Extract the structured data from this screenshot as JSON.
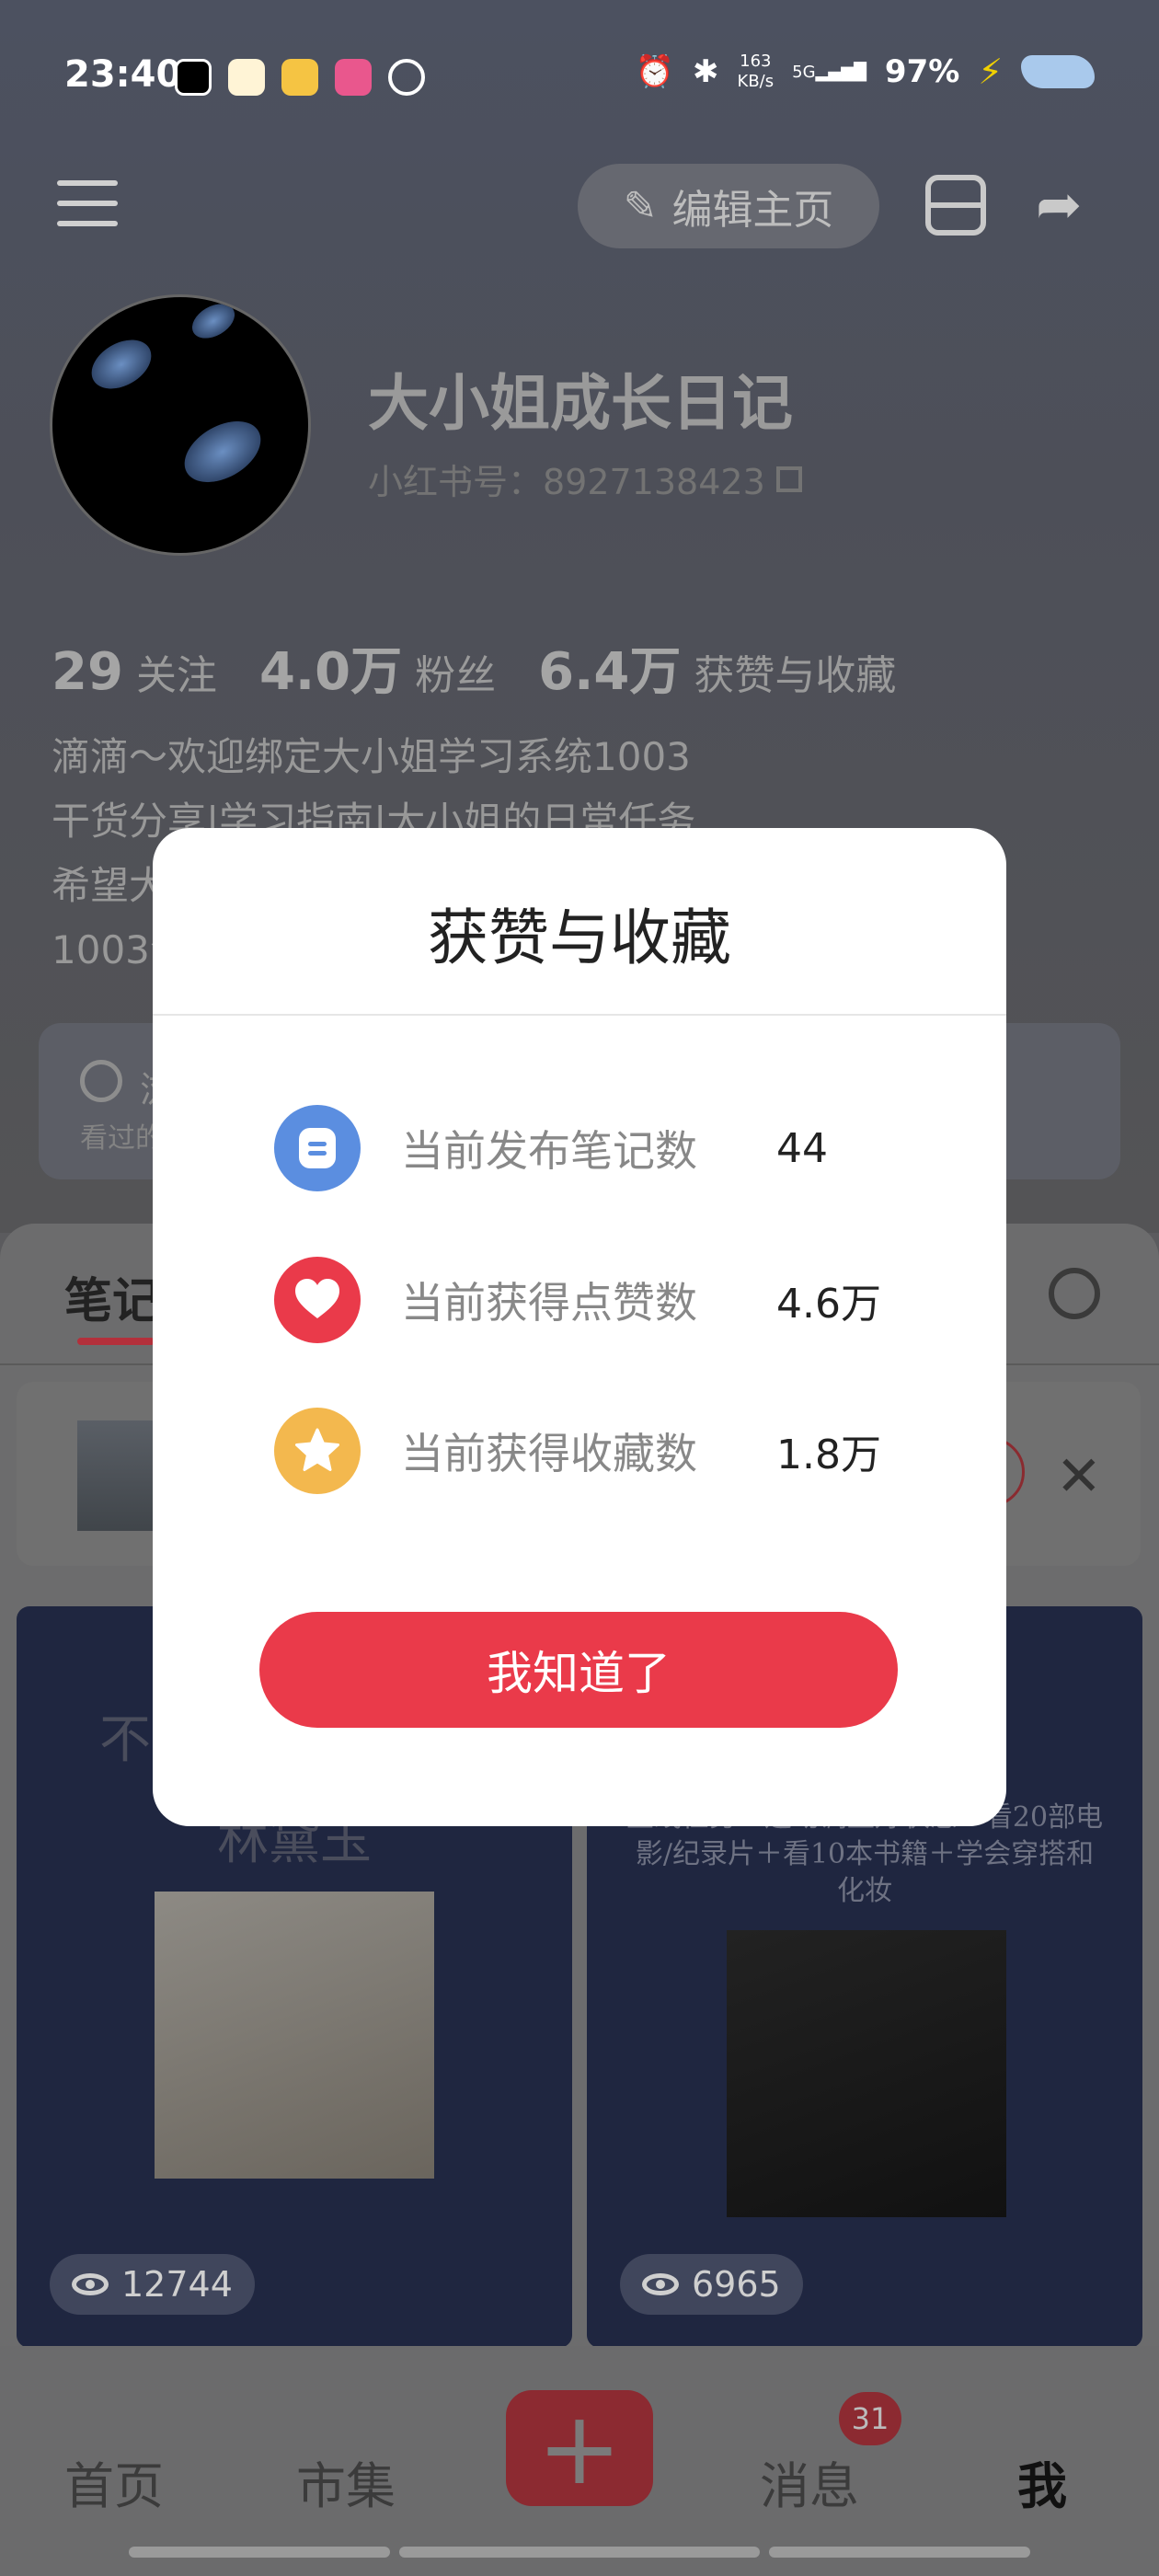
{
  "status_bar": {
    "time": "23:40",
    "net_speed_value": "163",
    "net_speed_unit": "KB/s",
    "signal_label": "5G",
    "battery": "97%"
  },
  "header": {
    "edit_profile_label": "编辑主页"
  },
  "profile": {
    "name": "大小姐成长日记",
    "id_line": "小红书号：8927138423",
    "stats": [
      {
        "value": "29",
        "label": "关注"
      },
      {
        "value": "4.0万",
        "label": "粉丝"
      },
      {
        "value": "6.4万",
        "label": "获赞与收藏"
      }
    ],
    "bio_lines": [
      "滴滴～欢迎绑定大小姐学习系统1003",
      "干货分享|学习指南|大小姐的日常任务",
      "希望大",
      "1003会"
    ]
  },
  "history": {
    "title": "浏",
    "subtitle": "看过的"
  },
  "sheet": {
    "tab_label": "笔记"
  },
  "notes": [
    {
      "title": "不们",
      "title2": "林黛玉",
      "views": "12744"
    },
    {
      "subtitle": "主线任务：运动调整好状态＋看20部电影/纪录片＋看10本书籍＋学会穿搭和化妆",
      "views": "6965"
    }
  ],
  "bottom_nav": {
    "items": [
      "首页",
      "市集",
      "消息",
      "我"
    ],
    "message_badge": "31"
  },
  "modal": {
    "title": "获赞与收藏",
    "rows": [
      {
        "label": "当前发布笔记数",
        "value": "44",
        "icon": "note-icon",
        "color": "#5b8ee0"
      },
      {
        "label": "当前获得点赞数",
        "value": "4.6万",
        "icon": "heart-icon",
        "color": "#ea3a4a"
      },
      {
        "label": "当前获得收藏数",
        "value": "1.8万",
        "icon": "star-icon",
        "color": "#f3b84e"
      }
    ],
    "confirm_label": "我知道了"
  }
}
